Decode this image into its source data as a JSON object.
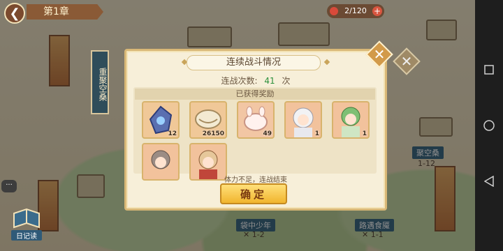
{
  "header": {
    "chapter_title": "第1章",
    "stamina": "2/120"
  },
  "side_scroll": {
    "label": "重聚空桑"
  },
  "map": {
    "stages": [
      {
        "name": "袋中少年",
        "sub": "1-2"
      },
      {
        "name": "路遇食魇",
        "sub": "1-1"
      },
      {
        "name": "聚空桑",
        "sub": "1-12"
      }
    ],
    "diary_label": "日记读",
    "chat_icon": "chat-icon"
  },
  "dialog": {
    "title": "连续战斗情况",
    "battle_count_label": "连战次数:",
    "battle_count_value": "41",
    "battle_count_unit": "次",
    "rewards_header": "已获得奖励",
    "items": [
      {
        "icon": "blue-crystal-icon",
        "qty": "12"
      },
      {
        "icon": "shell-icon",
        "qty": "26150"
      },
      {
        "icon": "bun-creature-icon",
        "qty": "49"
      },
      {
        "icon": "white-hair-character-icon",
        "qty": "1"
      },
      {
        "icon": "green-hair-character-icon",
        "qty": "1"
      },
      {
        "icon": "grey-hair-character-icon",
        "qty": ""
      },
      {
        "icon": "red-character-icon",
        "qty": ""
      }
    ],
    "end_message": "体力不足，连战结束",
    "confirm_label": "确定"
  },
  "colors": {
    "accent": "#f1b52e",
    "count_green": "#2a8f3a",
    "dialog_bg": "#f7efd9"
  }
}
